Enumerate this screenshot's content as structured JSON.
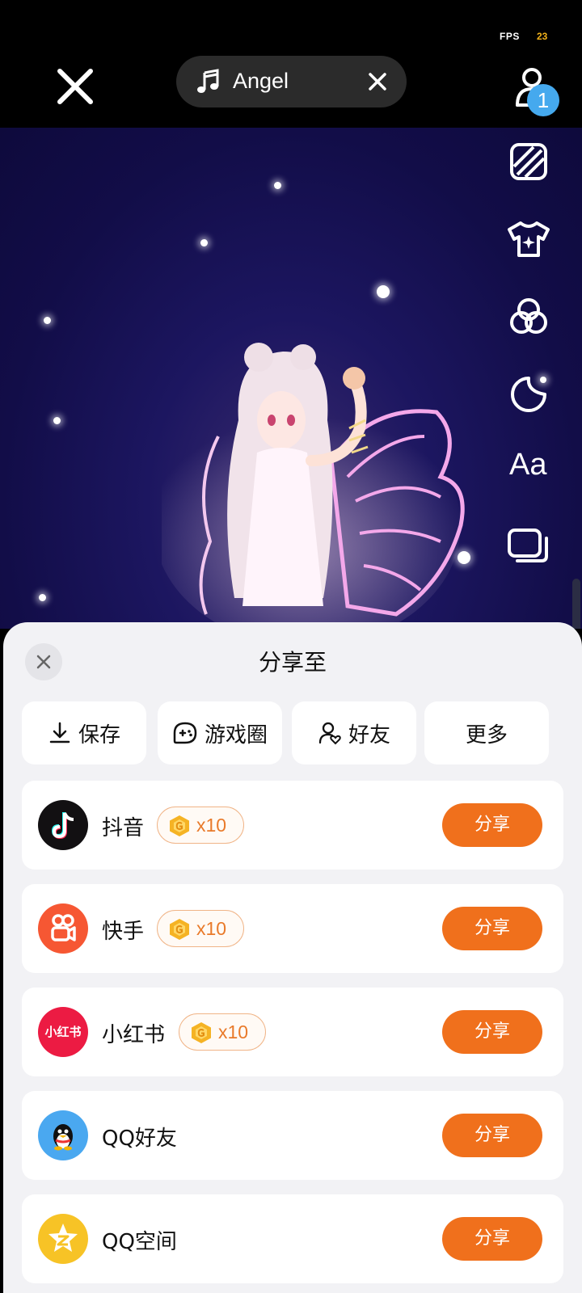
{
  "status": {
    "fps_label": "FPS",
    "fps_value": "23"
  },
  "music": {
    "title": "Angel"
  },
  "user": {
    "badge_count": "1"
  },
  "side_tools": {
    "text_tool_label": "Aa"
  },
  "sheet": {
    "title": "分享至",
    "quick_actions": [
      {
        "label": "保存",
        "icon": "download-icon"
      },
      {
        "label": "游戏圈",
        "icon": "game-circle-icon"
      },
      {
        "label": "好友",
        "icon": "friend-icon"
      },
      {
        "label": "更多",
        "icon": ""
      }
    ],
    "platforms": [
      {
        "name": "抖音",
        "reward": "x10",
        "share_label": "分享",
        "icon": "douyin-icon"
      },
      {
        "name": "快手",
        "reward": "x10",
        "share_label": "分享",
        "icon": "kuaishou-icon"
      },
      {
        "name": "小红书",
        "reward": "x10",
        "share_label": "分享",
        "icon": "xiaohongshu-icon",
        "icon_text": "小红书"
      },
      {
        "name": "QQ好友",
        "share_label": "分享",
        "icon": "qq-icon"
      },
      {
        "name": "QQ空间",
        "share_label": "分享",
        "icon": "qzone-icon"
      }
    ]
  },
  "colors": {
    "accent": "#f0701c",
    "badge": "#45a9ee",
    "fps_value": "#f2b21b",
    "sheet_bg": "#f2f2f5"
  }
}
